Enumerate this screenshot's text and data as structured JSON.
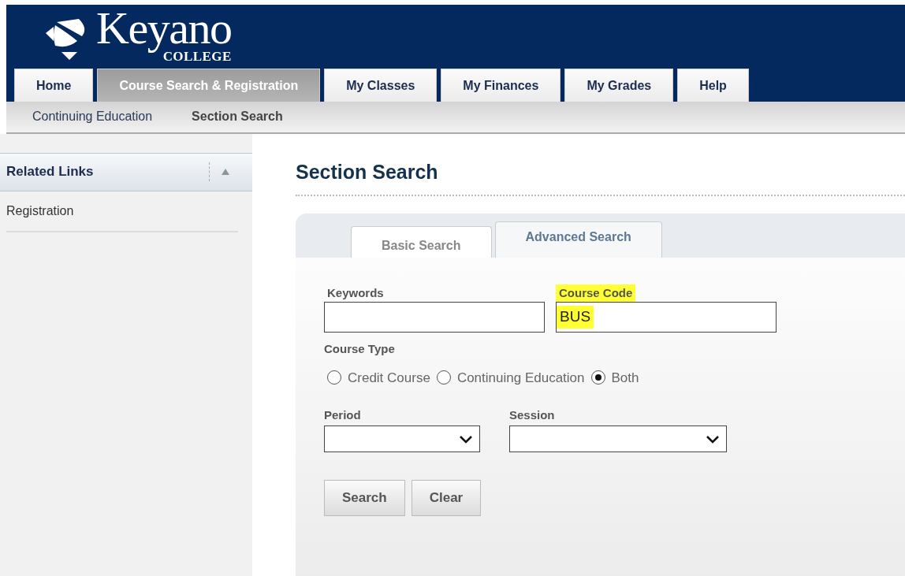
{
  "logo": {
    "name": "Keyano",
    "subtitle": "COLLEGE"
  },
  "tabs": [
    {
      "label": "Home",
      "selected": false
    },
    {
      "label": "Course Search & Registration",
      "selected": true
    },
    {
      "label": "My Classes",
      "selected": false
    },
    {
      "label": "My Finances",
      "selected": false
    },
    {
      "label": "My Grades",
      "selected": false
    },
    {
      "label": "Help",
      "selected": false
    }
  ],
  "subnav": [
    {
      "label": "Continuing Education",
      "selected": false
    },
    {
      "label": "Section Search",
      "selected": true
    }
  ],
  "sidebar": {
    "title": "Related Links",
    "expanded": true,
    "items": [
      "Registration"
    ]
  },
  "page_title": "Section Search",
  "search_tabs": [
    {
      "label": "Basic Search",
      "selected": true
    },
    {
      "label": "Advanced Search",
      "selected": false
    }
  ],
  "form": {
    "keywords": {
      "label": "Keywords"
    },
    "course_code": {
      "label": "Course Code",
      "value": "BUS",
      "highlighted": true
    },
    "course_type": {
      "label": "Course Type",
      "options": [
        {
          "label": "Credit Course",
          "selected": false
        },
        {
          "label": "Continuing Education",
          "selected": false
        },
        {
          "label": "Both",
          "selected": true
        }
      ]
    },
    "period": {
      "label": "Period"
    },
    "session": {
      "label": "Session"
    },
    "buttons": [
      "Search",
      "Clear"
    ]
  }
}
